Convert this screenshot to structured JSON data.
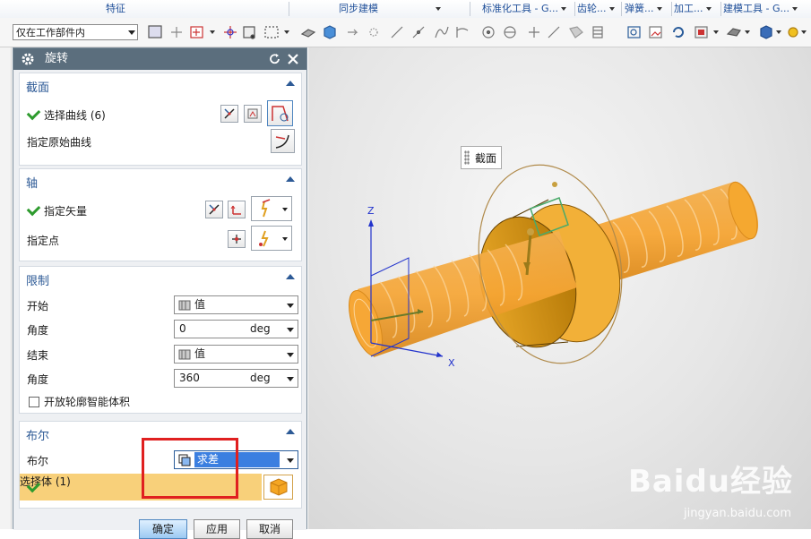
{
  "ribbon": {
    "groups": [
      "特征",
      "同步建模",
      "标准化工具 - G...",
      "齿轮...",
      "弹簧...",
      "加工...",
      "建模工具 - G..."
    ]
  },
  "toolbar": {
    "filter_value": "仅在工作部件内",
    "icons": [
      "snap-icon",
      "move-icon",
      "select-component-icon",
      "point-icon",
      "filter-icon",
      "box-select-icon",
      "solid-icon",
      "cube-icon",
      "arrow-icon",
      "node-icon",
      "line-icon",
      "line2-icon",
      "curve-icon",
      "tangent-icon",
      "circle-icon",
      "circle2-icon",
      "plus-icon",
      "slash-icon",
      "shade-icon",
      "table-icon",
      "view-icon",
      "image-icon",
      "refresh-icon",
      "layout-icon",
      "render-icon",
      "box-icon",
      "light-icon"
    ]
  },
  "dialog": {
    "title": "旋转",
    "section_section": {
      "header": "截面",
      "select_curve": "选择曲线 (6)",
      "origin_curve": "指定原始曲线"
    },
    "section_axis": {
      "header": "轴",
      "specify_vector": "指定矢量",
      "specify_point": "指定点"
    },
    "section_limits": {
      "header": "限制",
      "start_label": "开始",
      "start_value": "值",
      "angle_label": "角度",
      "start_angle": "0",
      "unit": "deg",
      "end_label": "结束",
      "end_value": "值",
      "end_angle_label": "角度",
      "end_angle": "360",
      "open_profile": "开放轮廓智能体积"
    },
    "section_boolean": {
      "header": "布尔",
      "boolean_label": "布尔",
      "boolean_value": "求差",
      "select_body": "选择体 (1)"
    },
    "buttons": {
      "ok": "确定",
      "apply": "应用",
      "cancel": "取消"
    }
  },
  "viewport": {
    "callout": "截面",
    "axis_z": "Z",
    "axis_x": "X",
    "colors": {
      "part": "#f0a030",
      "part_dark": "#d88a1c",
      "axis": "#2233cc"
    }
  },
  "watermark": {
    "brand": "Baidu经验",
    "url": "jingyan.baidu.com"
  }
}
